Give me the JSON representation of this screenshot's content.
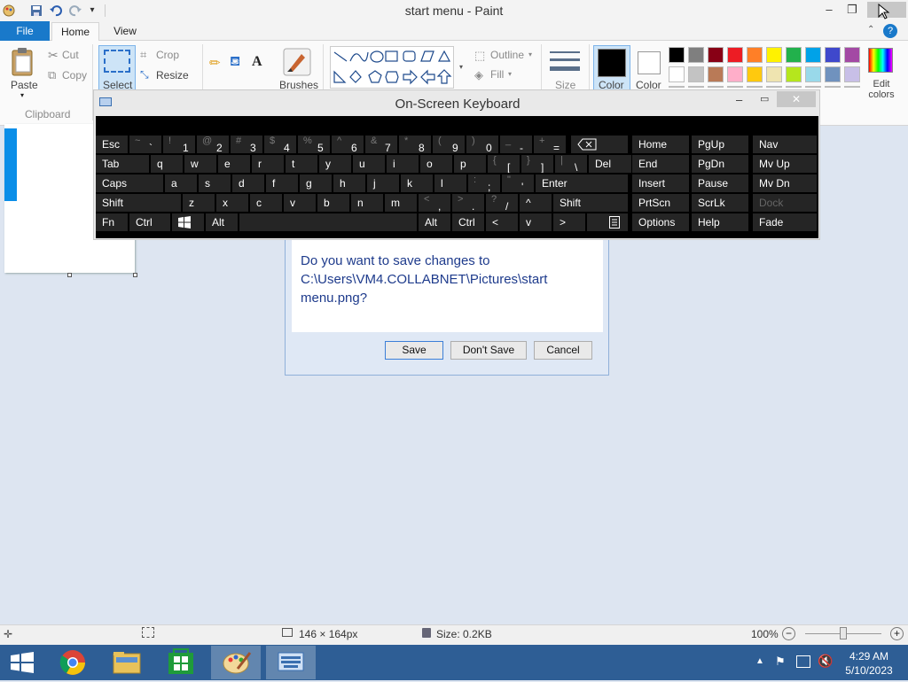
{
  "window": {
    "title": "start menu - Paint"
  },
  "quick_access": {
    "save_icon": "save-icon",
    "undo_icon": "undo-icon",
    "redo_icon": "redo-icon"
  },
  "tabs": {
    "file": "File",
    "home": "Home",
    "view": "View"
  },
  "ribbon": {
    "clipboard": {
      "paste": "Paste",
      "cut": "Cut",
      "copy": "Copy",
      "group": "Clipboard"
    },
    "image": {
      "select": "Select",
      "crop": "Crop",
      "resize": "Resize"
    },
    "tools": {
      "brushes": "Brushes"
    },
    "shapes": {
      "outline": "Outline",
      "fill": "Fill"
    },
    "size": "Size",
    "color1": "Color\n1",
    "color2": "Color\n2",
    "color1_label": "Color",
    "color2_label": "Color",
    "edit_colors": "Edit colors",
    "palette_row1": [
      "#000000",
      "#7f7f7f",
      "#880015",
      "#ed1c24",
      "#ff7f27",
      "#fff200",
      "#22b14c",
      "#00a2e8",
      "#3f48cc",
      "#a349a4"
    ],
    "palette_row2": [
      "#ffffff",
      "#c3c3c3",
      "#b97a57",
      "#ffaec9",
      "#ffc90e",
      "#efe4b0",
      "#b5e61d",
      "#99d9ea",
      "#7092be",
      "#c8bfe7"
    ]
  },
  "osk": {
    "title": "On-Screen Keyboard",
    "row1": [
      {
        "s": "~",
        "m": "`"
      },
      {
        "s": "!",
        "m": "1"
      },
      {
        "s": "@",
        "m": "2"
      },
      {
        "s": "#",
        "m": "3"
      },
      {
        "s": "$",
        "m": "4"
      },
      {
        "s": "%",
        "m": "5"
      },
      {
        "s": "^",
        "m": "6"
      },
      {
        "s": "&",
        "m": "7"
      },
      {
        "s": "*",
        "m": "8"
      },
      {
        "s": "(",
        "m": "9"
      },
      {
        "s": ")",
        "m": "0"
      },
      {
        "s": "_",
        "m": "-"
      },
      {
        "s": "+",
        "m": "="
      }
    ],
    "keys": {
      "esc": "Esc",
      "tab": "Tab",
      "caps": "Caps",
      "shift_l": "Shift",
      "fn": "Fn",
      "ctrl_l": "Ctrl",
      "alt_l": "Alt",
      "del": "Del",
      "enter": "Enter",
      "shift_r": "Shift",
      "alt_r": "Alt",
      "ctrl_r": "Ctrl",
      "q": "q",
      "w": "w",
      "e": "e",
      "r": "r",
      "t": "t",
      "y": "y",
      "u": "u",
      "i": "i",
      "o": "o",
      "p": "p",
      "lbr_s": "{",
      "lbr": "[",
      "rbr_s": "}",
      "rbr": "]",
      "pipe_s": "|",
      "bslash": "\\",
      "a": "a",
      "s": "s",
      "d": "d",
      "f": "f",
      "g": "g",
      "h": "h",
      "j": "j",
      "k": "k",
      "l": "l",
      "semi_s": ":",
      "semi": ";",
      "quote_s": "\"",
      "quote": "'",
      "z": "z",
      "x": "x",
      "c": "c",
      "v": "v",
      "b": "b",
      "n": "n",
      "m": "m",
      "comma_s": "<",
      "comma": ",",
      "period_s": ">",
      "period": ".",
      "slash_s": "?",
      "slash": "/",
      "up": "^",
      "left": "<",
      "down": "v",
      "right": ">",
      "home": "Home",
      "pgup": "PgUp",
      "nav": "Nav",
      "end": "End",
      "pgdn": "PgDn",
      "mvup": "Mv Up",
      "insert": "Insert",
      "pause": "Pause",
      "mvdn": "Mv Dn",
      "prtscn": "PrtScn",
      "scrlk": "ScrLk",
      "dock": "Dock",
      "options": "Options",
      "help": "Help",
      "fade": "Fade"
    }
  },
  "dialog": {
    "line1": "Do you want to save changes to",
    "line2": "C:\\Users\\VM4.COLLABNET\\Pictures\\start",
    "line3": "menu.png?",
    "save": "Save",
    "dont_save": "Don't Save",
    "cancel": "Cancel"
  },
  "status": {
    "dimensions": "146 × 164px",
    "size": "Size: 0.2KB",
    "zoom": "100%"
  },
  "clock": {
    "time": "4:29 AM",
    "date": "5/10/2023"
  }
}
